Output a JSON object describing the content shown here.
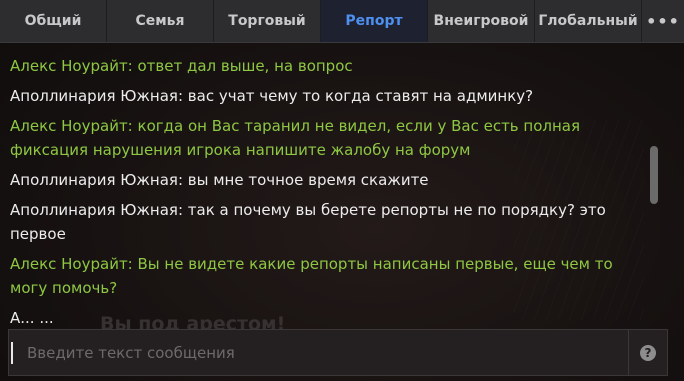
{
  "tabs": [
    {
      "label": "Общий",
      "width": 107,
      "active": false
    },
    {
      "label": "Семья",
      "width": 107,
      "active": false
    },
    {
      "label": "Торговый",
      "width": 107,
      "active": false
    },
    {
      "label": "Репорт",
      "width": 107,
      "active": true
    },
    {
      "label": "Внеигровой",
      "width": 107,
      "active": false
    },
    {
      "label": "Глобальный",
      "width": 107,
      "active": false
    },
    {
      "label": "•••",
      "width": 42,
      "active": false
    }
  ],
  "messages": [
    {
      "text": "Алекс Ноурайт: ответ дал выше, на вопрос",
      "role": "admin"
    },
    {
      "text": "Аполлинария Южная: вас учат чему то когда ставят на админку?",
      "role": "player"
    },
    {
      "text": "Алекс Ноурайт: когда он Вас таранил не видел, если у Вас есть полная фиксация нарушения игрока напишите жалобу на форум",
      "role": "admin"
    },
    {
      "text": "Аполлинария Южная: вы мне точное время скажите",
      "role": "player"
    },
    {
      "text": "Аполлинария Южная: так а почему вы берете репорты не по порядку? это первое",
      "role": "player"
    },
    {
      "text": "Алекс Ноурайт: Вы не видете какие репорты написаны первые, еще чем то могу помочь?",
      "role": "admin"
    },
    {
      "text": "А... ...",
      "role": "player"
    }
  ],
  "overlay_text": "Вы под арестом!",
  "input": {
    "placeholder": "Введите текст сообщения",
    "value": ""
  },
  "help_label": "?",
  "colors": {
    "admin": "#8ec742",
    "player": "#ececec",
    "active_tab": "#4e8ff0"
  }
}
